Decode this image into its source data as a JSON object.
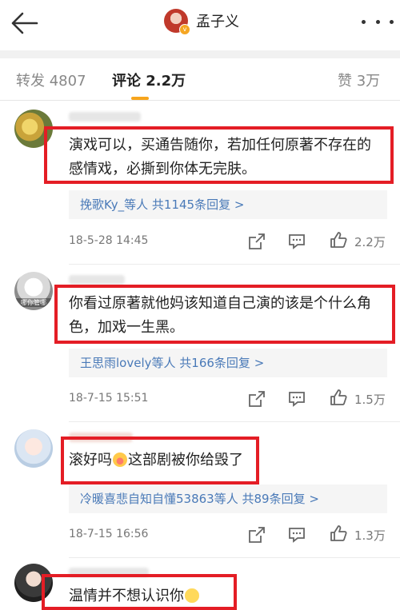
{
  "header": {
    "title": "孟子义"
  },
  "tabs": [
    {
      "label": "转发 4807"
    },
    {
      "label": "评论 2.2万"
    },
    {
      "label": "赞 3万"
    }
  ],
  "comments": [
    {
      "lines": [
        "演戏可以，买通告随你，若加任何原著不存在的",
        "感情戏，必撕到你体无完肤。"
      ],
      "reply": {
        "names": "挽歌Ky_等人",
        "count": "共1145条回复",
        "arrow": ">"
      },
      "date": "18-5-28 14:45",
      "likes": "2.2万"
    },
    {
      "lines": [
        "你看过原著就他妈该知道自己演的该是个什么角",
        "色，加戏一生黑。"
      ],
      "avatar_caption": "哪你管哪",
      "reply": {
        "names": "王思雨lovely等人",
        "count": "共166条回复",
        "arrow": ">"
      },
      "date": "18-7-15 15:51",
      "likes": "1.5万"
    },
    {
      "line_a": "滚好吗",
      "line_b": "这部剧被你给毁了",
      "reply": {
        "names": "冷暖喜悲自知自懂53863等人",
        "count": "共89条回复",
        "arrow": ">"
      },
      "date": "18-7-15 16:56",
      "likes": "1.3万"
    },
    {
      "line_a": "温情并不想认识你"
    }
  ],
  "colors": {
    "highlight_box": "#e41d25",
    "tab_accent": "#f7a51c",
    "link": "#4a7ab8"
  },
  "icons": [
    "back-arrow-icon",
    "more-icon",
    "share-icon",
    "comment-icon",
    "like-icon"
  ]
}
